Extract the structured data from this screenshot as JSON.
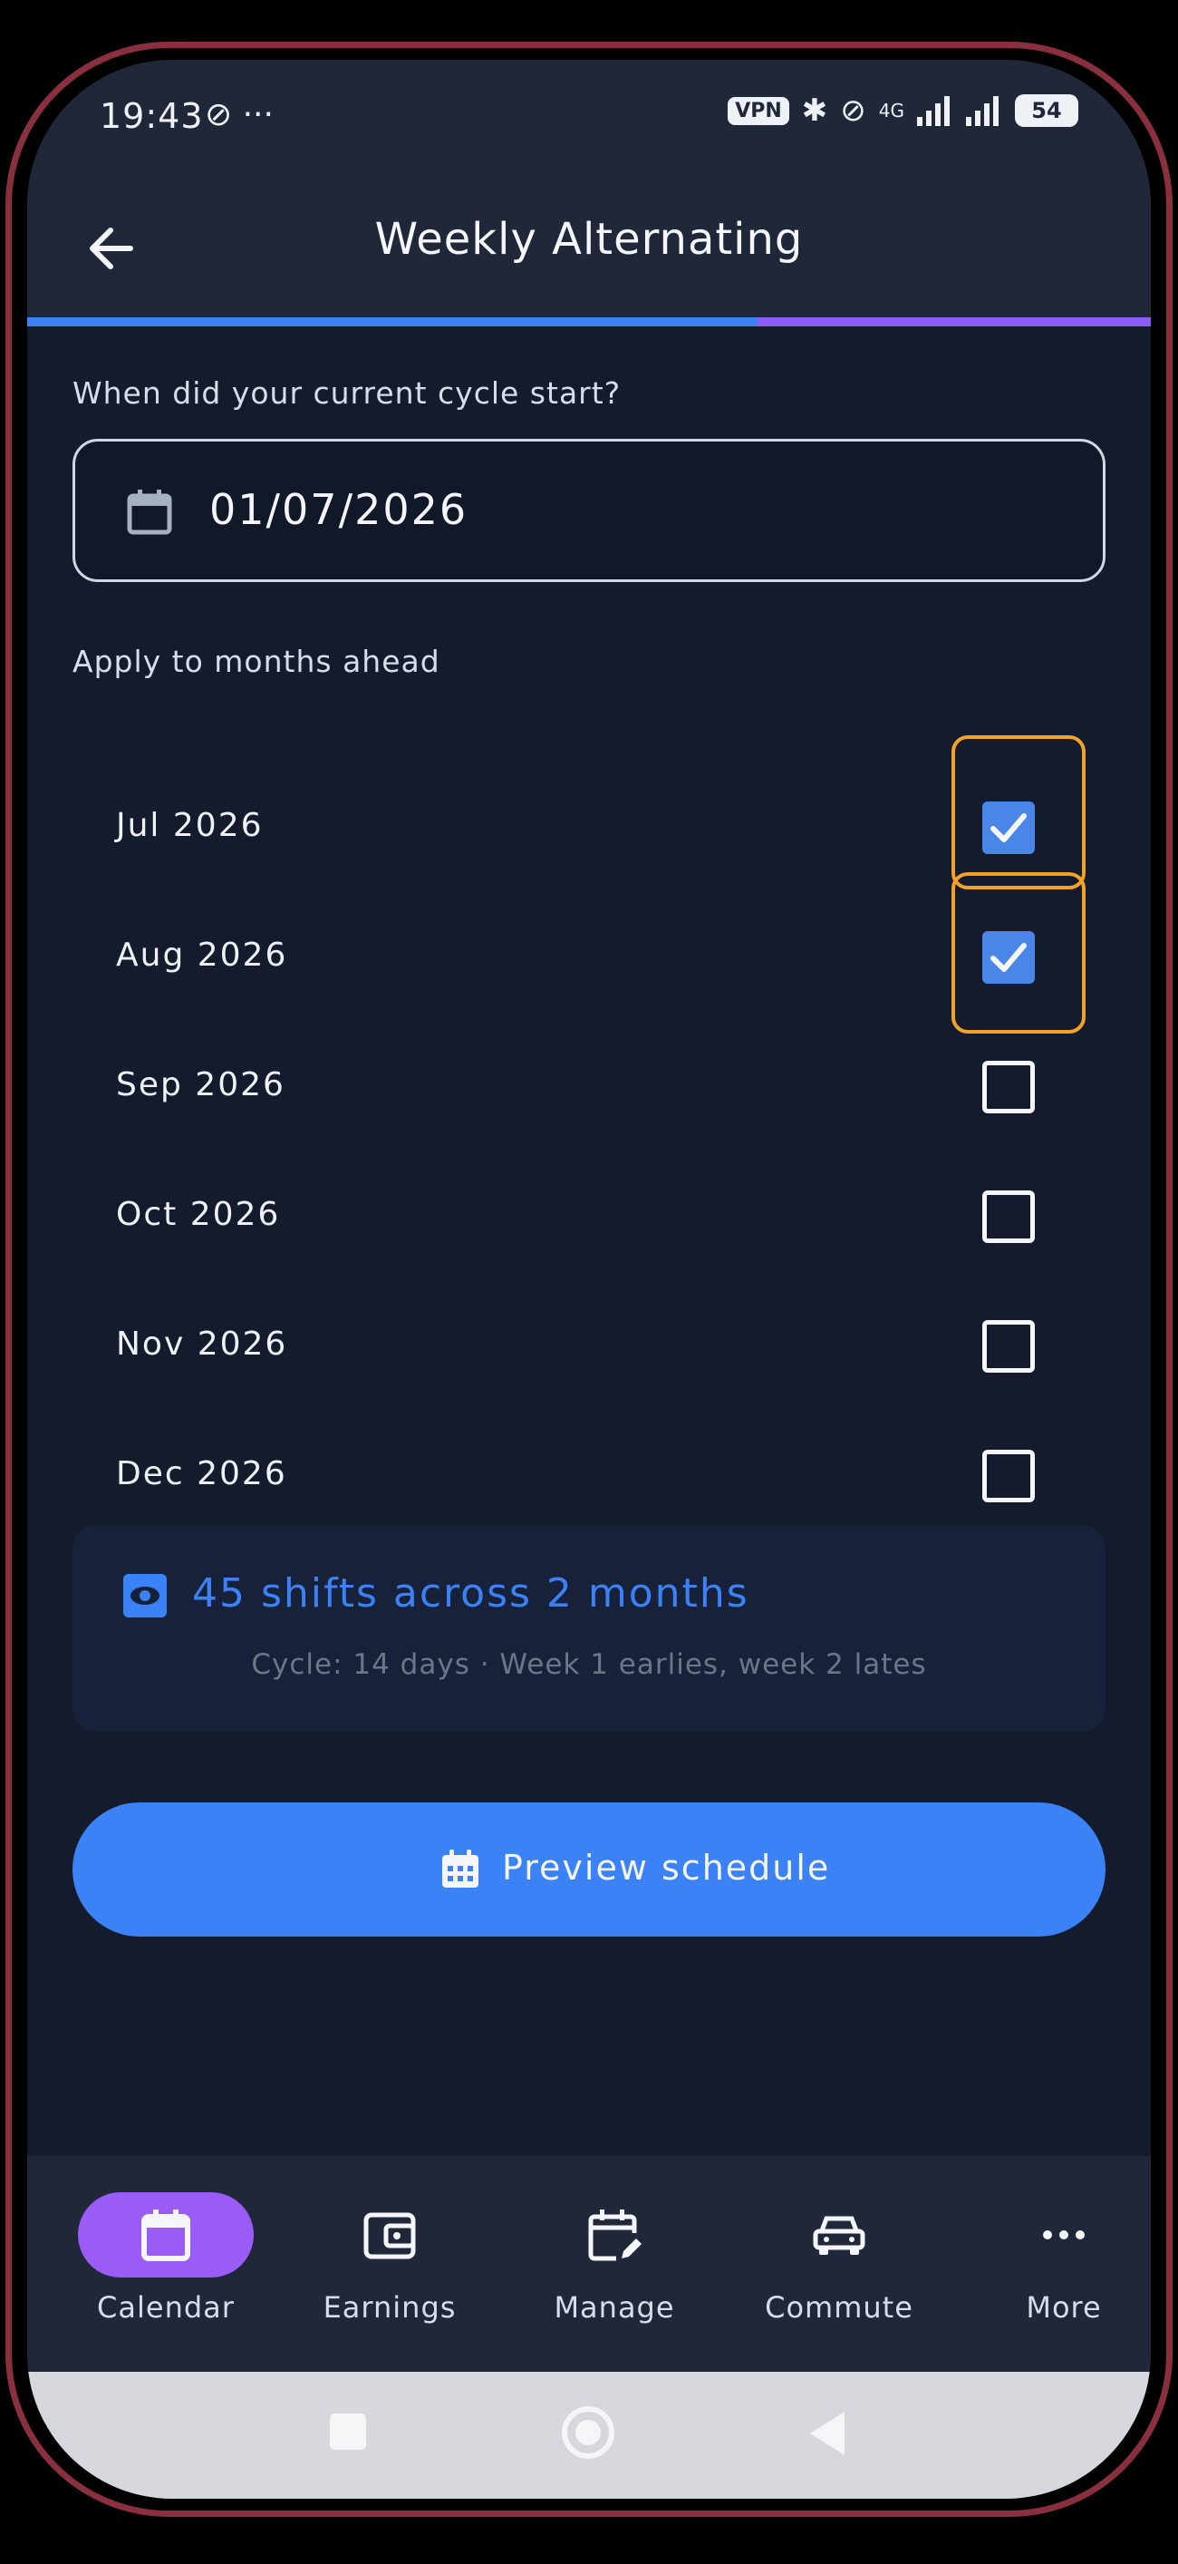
{
  "status_bar": {
    "time": "19:43",
    "left_icons": "⊘ ···",
    "vpn": "VPN",
    "network": "4G",
    "battery": "54"
  },
  "header": {
    "title": "Weekly Alternating",
    "progress": 0.65,
    "progress_color": "#3b82f6",
    "track_color": "#8b5cf6"
  },
  "cycle": {
    "question": "When did your current cycle start?",
    "date_value": "01/07/2026"
  },
  "months": {
    "label": "Apply to months ahead",
    "items": [
      {
        "label": "Jul 2026",
        "checked": true
      },
      {
        "label": "Aug 2026",
        "checked": true
      },
      {
        "label": "Sep 2026",
        "checked": false
      },
      {
        "label": "Oct 2026",
        "checked": false
      },
      {
        "label": "Nov 2026",
        "checked": false
      },
      {
        "label": "Dec 2026",
        "checked": false
      }
    ]
  },
  "summary": {
    "main": "45 shifts across 2 months",
    "sub": "Cycle: 14 days · Week 1 earlies, week 2 lates"
  },
  "preview_button": {
    "label": "Preview schedule"
  },
  "bottom_nav": {
    "items": [
      {
        "label": "Calendar",
        "icon": "calendar-icon",
        "active": true
      },
      {
        "label": "Earnings",
        "icon": "wallet-icon",
        "active": false
      },
      {
        "label": "Manage",
        "icon": "calendar-edit-icon",
        "active": false
      },
      {
        "label": "Commute",
        "icon": "car-icon",
        "active": false
      },
      {
        "label": "More",
        "icon": "more-icon",
        "active": false
      }
    ]
  },
  "colors": {
    "accent": "#3b82f6",
    "active_nav": "#9b5cf6",
    "highlight": "#f2a227"
  }
}
